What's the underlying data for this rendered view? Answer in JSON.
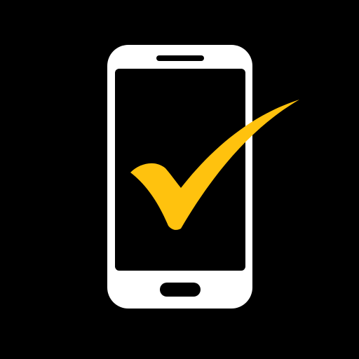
{
  "icon": {
    "name": "smartphone-checkmark-icon",
    "parts": [
      "smartphone-icon",
      "checkmark-icon"
    ]
  },
  "colors": {
    "background": "#000000",
    "phone_body": "#FFFFFF",
    "screen": "#000000",
    "checkmark": "#FFC20E"
  }
}
